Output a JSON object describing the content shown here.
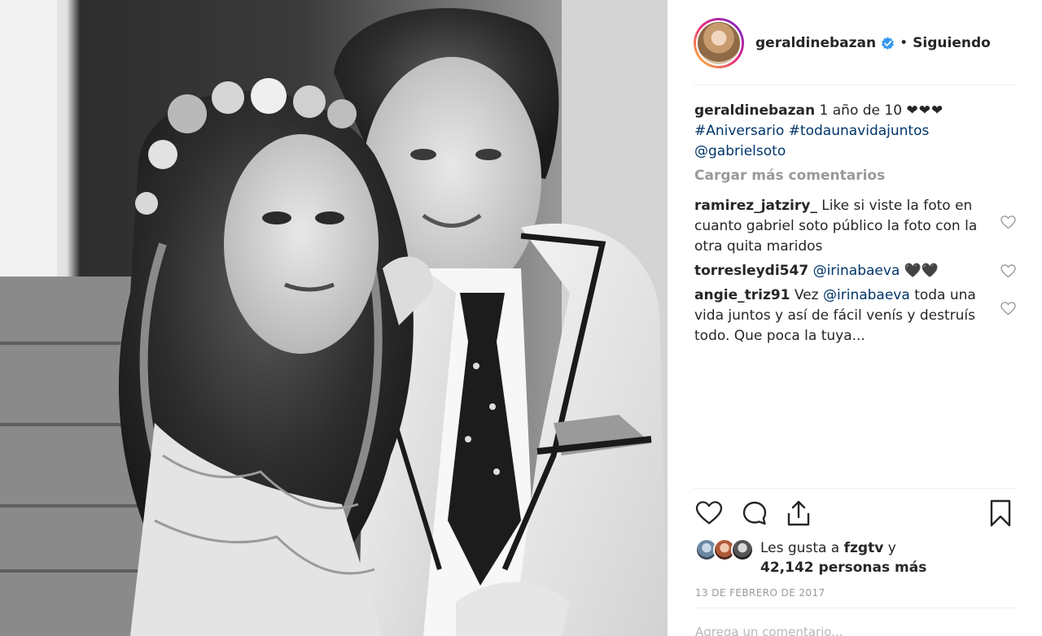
{
  "post": {
    "username": "geraldinebazan",
    "follow_status": "Siguiendo",
    "separator": "•",
    "verified": true
  },
  "caption": {
    "username": "geraldinebazan",
    "text": "1 año de 10",
    "hearts": "❤❤❤",
    "hashtag1": "#Aniversario",
    "hashtag2": "#todaunavidajuntos",
    "mention": "@gabrielsoto"
  },
  "load_more": "Cargar más comentarios",
  "comments": [
    {
      "username": "ramirez_jatziry_",
      "text": "Like si viste la foto en cuanto gabriel soto público la foto con la otra quita maridos"
    },
    {
      "username": "torresleydi547",
      "mention": "@irinabaeva",
      "hearts": "🖤🖤"
    },
    {
      "username": "angie_triz91",
      "prefix": "Vez",
      "mention": "@irinabaeva",
      "text": "toda una vida juntos y así de fácil venís y destruís todo. Que poca la tuya..."
    }
  ],
  "likes": {
    "prefix": "Les gusta a",
    "user": "fzgtv",
    "suffix": "y",
    "count_text": "42,142 personas más"
  },
  "timestamp": "13 DE FEBRERO DE 2017",
  "add_comment_placeholder": "Agrega un comentario...",
  "icons": {
    "like": "heart-icon",
    "comment": "comment-bubble-icon",
    "share": "share-upload-icon",
    "save": "bookmark-icon",
    "verified": "verified-badge-icon"
  },
  "colors": {
    "verified_blue": "#3897f0",
    "hashtag_link": "#003569",
    "muted": "#999999",
    "text": "#262626"
  }
}
